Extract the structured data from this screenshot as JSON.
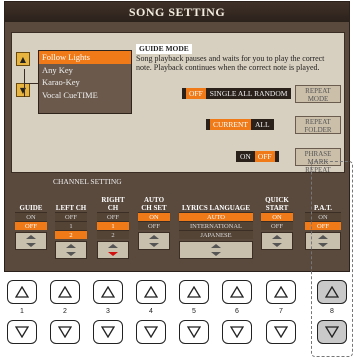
{
  "window": {
    "title": "SONG SETTING"
  },
  "guide": {
    "modes": [
      "Follow Lights",
      "Any Key",
      "Karao-Key",
      "Vocal CueTIME"
    ],
    "mode_title": "GUIDE MODE",
    "description": "Song playback pauses and waits for you to play the correct note. Playback continues when the correct note is played."
  },
  "options": {
    "repeat_row": {
      "selected": "OFF",
      "others": "SINGLE ALL RANDOM"
    },
    "repeat_mode_button": "REPEAT MODE",
    "folder_row": {
      "selected": "CURRENT",
      "others": "ALL"
    },
    "repeat_folder_button": "REPEAT FOLDER",
    "phrase_row": {
      "on": "ON",
      "selected": "OFF"
    },
    "phrase_mark_button": "PHRASE MARK REPEAT"
  },
  "settings": {
    "channel_setting_label": "CHANNEL SETTING",
    "columns": [
      {
        "head": "GUIDE",
        "values": [
          "ON",
          "OFF"
        ],
        "selected": 1
      },
      {
        "head": "LEFT CH",
        "values": [
          "OFF",
          "1",
          "2"
        ],
        "selected": 2
      },
      {
        "head": "RIGHT CH",
        "values": [
          "OFF",
          "1",
          "2"
        ],
        "selected": 1
      },
      {
        "head": "AUTO CH SET",
        "values": [
          "ON",
          "OFF"
        ],
        "selected": 0
      },
      {
        "head": "LYRICS LANGUAGE",
        "values": [
          "AUTO",
          "INTERNATIONAL",
          "JAPANESE"
        ],
        "selected": 0
      },
      {
        "head": "QUICK START",
        "values": [
          "ON",
          "OFF"
        ],
        "selected": 0
      },
      {
        "head": "P.A.T.",
        "values": [
          "ON",
          "OFF"
        ],
        "selected": 1
      }
    ]
  },
  "hardware": {
    "numbers": [
      "1",
      "2",
      "3",
      "4",
      "5",
      "6",
      "7",
      "8"
    ]
  },
  "colors": {
    "accent": "#f07a18",
    "screen": "#5a4a3e",
    "panel": "#d7cfbf"
  }
}
